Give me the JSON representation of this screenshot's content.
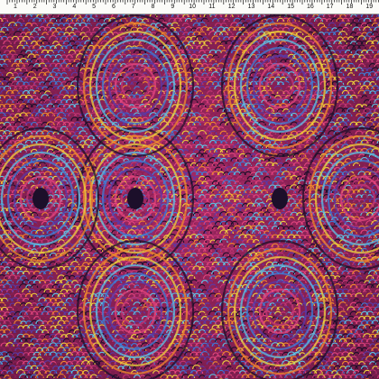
{
  "ruler": {
    "labels": [
      "1",
      "2",
      "3",
      "4",
      "5",
      "6",
      "7",
      "8",
      "9",
      "10",
      "11",
      "12",
      "13",
      "14",
      "15",
      "16",
      "17",
      "18",
      "19"
    ]
  },
  "pattern": {
    "description_icon": "marbled-feather-pattern",
    "palette": [
      "#8a1f55",
      "#c23575",
      "#e3467e",
      "#5a3aa8",
      "#3d7fd8",
      "#5cc6e8",
      "#f0d43c",
      "#f28a2c",
      "#1c0f2a"
    ]
  }
}
